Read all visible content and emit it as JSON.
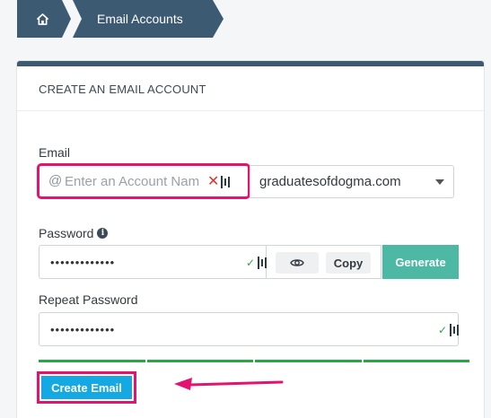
{
  "breadcrumb": {
    "home_icon": "home-icon",
    "current": "Email Accounts"
  },
  "panel": {
    "title": "CREATE AN EMAIL ACCOUNT"
  },
  "email": {
    "label": "Email",
    "placeholder": "Enter an Account Name",
    "domain": "graduatesofdogma.com"
  },
  "password": {
    "label": "Password",
    "value": "•••••••••••••",
    "show_icon": "eye-icon",
    "copy_label": "Copy",
    "generate_label": "Generate"
  },
  "repeat_password": {
    "label": "Repeat Password",
    "value": "•••••••••••••"
  },
  "strength_meter": {
    "filled_segments": 4,
    "total_segments": 4
  },
  "actions": {
    "create_label": "Create Email"
  },
  "colors": {
    "header": "#3d5a73",
    "accent": "#15a9e3",
    "generate": "#4db8a4",
    "highlight": "#e4136f",
    "strength": "#28a745"
  }
}
